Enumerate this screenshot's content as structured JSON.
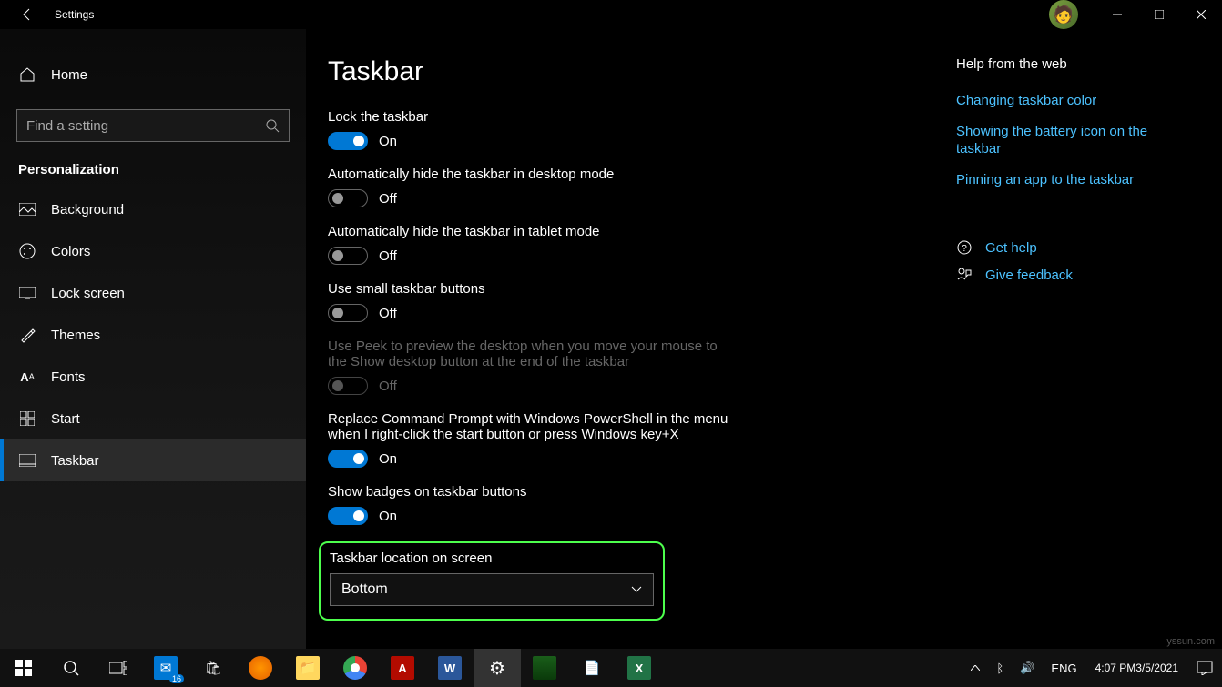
{
  "titlebar": {
    "title": "Settings"
  },
  "sidebar": {
    "home": "Home",
    "search_placeholder": "Find a setting",
    "section": "Personalization",
    "items": [
      {
        "label": "Background"
      },
      {
        "label": "Colors"
      },
      {
        "label": "Lock screen"
      },
      {
        "label": "Themes"
      },
      {
        "label": "Fonts"
      },
      {
        "label": "Start"
      },
      {
        "label": "Taskbar"
      }
    ]
  },
  "page": {
    "title": "Taskbar",
    "settings": {
      "lock": {
        "label": "Lock the taskbar",
        "state": "On"
      },
      "autohide_desktop": {
        "label": "Automatically hide the taskbar in desktop mode",
        "state": "Off"
      },
      "autohide_tablet": {
        "label": "Automatically hide the taskbar in tablet mode",
        "state": "Off"
      },
      "small_buttons": {
        "label": "Use small taskbar buttons",
        "state": "Off"
      },
      "peek": {
        "label": "Use Peek to preview the desktop when you move your mouse to the Show desktop button at the end of the taskbar",
        "state": "Off"
      },
      "powershell": {
        "label": "Replace Command Prompt with Windows PowerShell in the menu when I right-click the start button or press Windows key+X",
        "state": "On"
      },
      "badges": {
        "label": "Show badges on taskbar buttons",
        "state": "On"
      },
      "location": {
        "label": "Taskbar location on screen",
        "value": "Bottom"
      }
    }
  },
  "help": {
    "title": "Help from the web",
    "links": [
      "Changing taskbar color",
      "Showing the battery icon on the taskbar",
      "Pinning an app to the taskbar"
    ],
    "get_help": "Get help",
    "feedback": "Give feedback"
  },
  "taskbar": {
    "mail_badge": "16",
    "lang": "ENG",
    "time": "4:07 PM",
    "date": "3/5/2021"
  },
  "watermark": "yssun.com"
}
